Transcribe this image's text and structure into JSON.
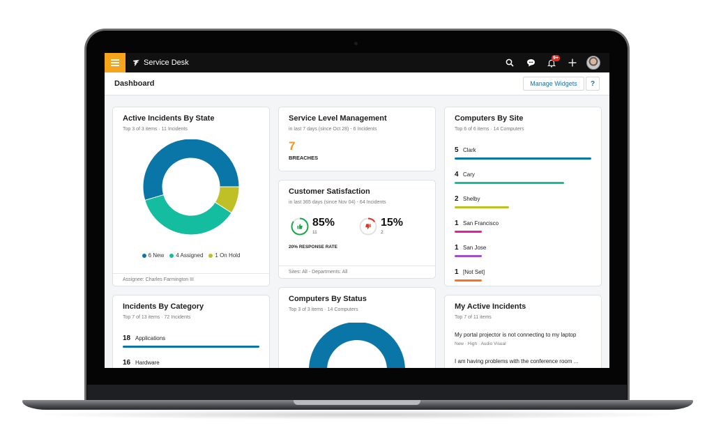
{
  "app": {
    "title": "Service Desk",
    "notification_count": "9+",
    "icons": [
      "menu-icon",
      "service-desk-logo-icon",
      "search-icon",
      "chat-icon",
      "bell-icon",
      "plus-icon",
      "avatar"
    ]
  },
  "header": {
    "title": "Dashboard",
    "manage_widgets": "Manage Widgets",
    "help": "?"
  },
  "colors": {
    "accent": "#f7a41d",
    "blue": "#0a76a8",
    "teal": "#14bca0",
    "olive": "#bfbf26",
    "magenta": "#ee1c9c",
    "purple": "#9b4fd4",
    "orange": "#f7761d",
    "green": "#1aa84b",
    "red": "#e4301b"
  },
  "widgets": {
    "active_incidents": {
      "title": "Active Incidents By State",
      "subtitle": "Top 3 of 3 items  ·  11 Incidents",
      "footer": "Assignee: Charles Farmington III",
      "legend": [
        {
          "label": "6 New"
        },
        {
          "label": "4 Assigned"
        },
        {
          "label": "1 On Hold"
        }
      ]
    },
    "slm": {
      "title": "Service Level Management",
      "subtitle": "in last 7 days (since Oct 28)  -  6 Incidents",
      "value": "7",
      "label": "BREACHES"
    },
    "csat": {
      "title": "Customer Satisfaction",
      "subtitle": "in last 365 days (since Nov 04)  -  64 Incidents",
      "positive": {
        "pct": "85%",
        "count": "11",
        "fraction": 0.85
      },
      "negative": {
        "pct": "15%",
        "count": "2",
        "fraction": 0.15
      },
      "response_rate": "20% RESPONSE RATE",
      "footer": "Sites: All  -  Departments: All"
    },
    "computers_by_site": {
      "title": "Computers By Site",
      "subtitle": "Top 6 of 6 items  ·  14 Computers",
      "items": [
        {
          "count": "5",
          "label": "Clark",
          "value": 5,
          "color": "#0a76a8"
        },
        {
          "count": "4",
          "label": "Cary",
          "value": 4,
          "color": "#14bca0"
        },
        {
          "count": "2",
          "label": "Shelby",
          "value": 2,
          "color": "#bfbf26"
        },
        {
          "count": "1",
          "label": "San Francisco",
          "value": 1,
          "color": "#ee1c9c"
        },
        {
          "count": "1",
          "label": "San Jose",
          "value": 1,
          "color": "#9b4fd4"
        },
        {
          "count": "1",
          "label": "[Not Set]",
          "value": 1,
          "color": "#f7761d"
        }
      ]
    },
    "incidents_by_category": {
      "title": "Incidents By Category",
      "subtitle": "Top 7 of 13 items  ·  72 Incidents",
      "items": [
        {
          "count": "18",
          "label": "Applications",
          "value": 18,
          "color": "#0a76a8"
        },
        {
          "count": "16",
          "label": "Hardware",
          "value": 16,
          "color": "#14bca0"
        }
      ]
    },
    "computers_by_status": {
      "title": "Computers By Status",
      "subtitle": "Top 3 of 3 items  ·  14 Computers"
    },
    "my_incidents": {
      "title": "My Active Incidents",
      "subtitle": "Top 7 of 11 items",
      "items": [
        {
          "title": "My portal projector is not connecting to my laptop",
          "meta": "New  ·  High  ·  Audio Visual"
        },
        {
          "title": "I am having problems with the conference room ...",
          "meta": ""
        }
      ]
    }
  },
  "chart_data": [
    {
      "type": "pie",
      "title": "Active Incidents By State",
      "categories": [
        "New",
        "Assigned",
        "On Hold"
      ],
      "values": [
        6,
        4,
        1
      ],
      "colors": [
        "#0a76a8",
        "#14bca0",
        "#bfbf26"
      ],
      "legend": "bottom"
    },
    {
      "type": "bar",
      "title": "Computers By Site",
      "categories": [
        "Clark",
        "Cary",
        "Shelby",
        "San Francisco",
        "San Jose",
        "[Not Set]"
      ],
      "values": [
        5,
        4,
        2,
        1,
        1,
        1
      ]
    },
    {
      "type": "bar",
      "title": "Incidents By Category",
      "categories": [
        "Applications",
        "Hardware"
      ],
      "values": [
        18,
        16
      ]
    }
  ]
}
